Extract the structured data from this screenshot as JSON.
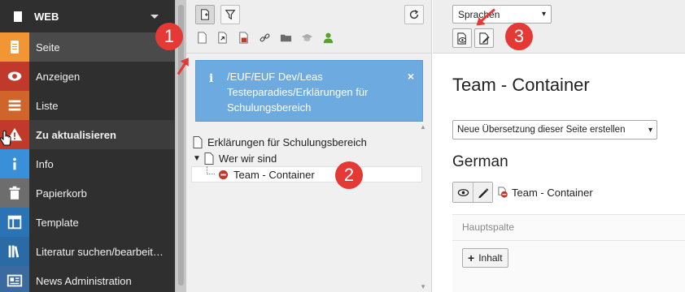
{
  "module_menu": {
    "site_name": "WEB",
    "items": [
      {
        "label": "Seite",
        "icon": "page-icon",
        "color": "#f29533"
      },
      {
        "label": "Anzeigen",
        "icon": "eye-icon",
        "color": "#c0392b"
      },
      {
        "label": "Liste",
        "icon": "list-icon",
        "color": "#d0652b"
      },
      {
        "label": "Zu aktualisieren",
        "icon": "warning-icon",
        "color": "#c0392b"
      },
      {
        "label": "Info",
        "icon": "info-icon",
        "color": "#3a8fd9"
      },
      {
        "label": "Papierkorb",
        "icon": "trash-icon",
        "color": "#6d6d6d"
      },
      {
        "label": "Template",
        "icon": "template-icon",
        "color": "#2a74b5"
      },
      {
        "label": "Literatur suchen/bearbeit…",
        "icon": "books-icon",
        "color": "#2a6aa5"
      },
      {
        "label": "News Administration",
        "icon": "news-icon",
        "color": "#3a6aa0"
      }
    ]
  },
  "page_tree": {
    "info_text": "/EUF/EUF Dev/Leas Testeparadies/Erklärungen für Schulungsbereich",
    "info_close": "×",
    "nodes": [
      {
        "label": "Erklärungen für Schulungsbereich"
      },
      {
        "label": "Wer wir sind",
        "toggle": "▼"
      },
      {
        "label": "Team - Container"
      }
    ]
  },
  "content": {
    "language_select": "Sprachen",
    "page_title": "Team - Container",
    "translate_select": "Neue Übersetzung dieser Seite erstellen",
    "language_heading": "German",
    "record_title": "Team - Container",
    "column_label": "Hauptspalte",
    "add_content_label": "Inhalt"
  },
  "annotations": [
    "1",
    "2",
    "3"
  ],
  "colors": {
    "accent_red": "#e53935",
    "info_blue": "#6daae0",
    "menu_bg": "#2f2f2f"
  }
}
